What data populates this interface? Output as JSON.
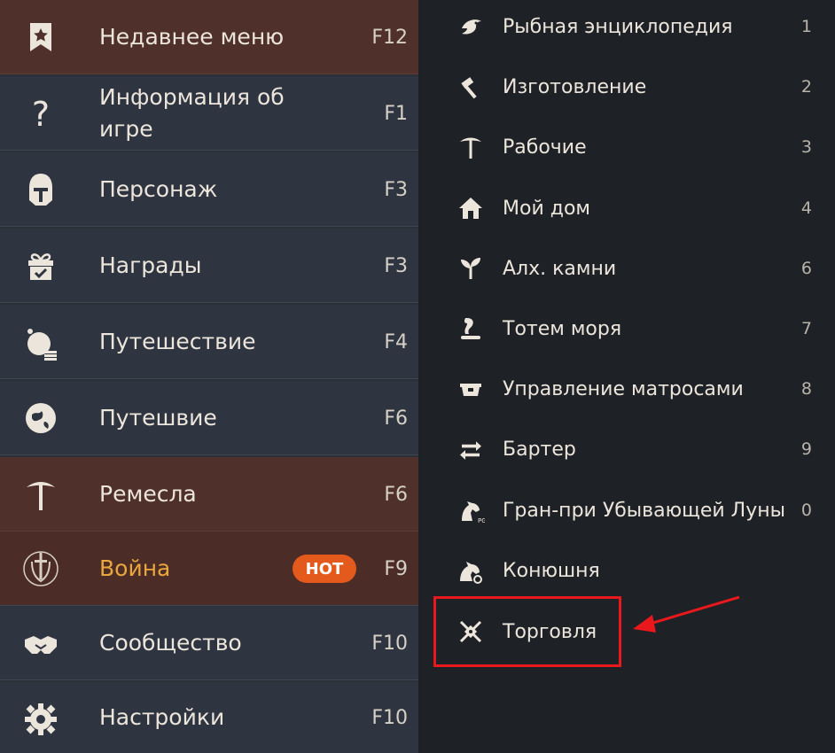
{
  "left_menu": [
    {
      "label": "Недавнее меню",
      "key": "F12",
      "icon": "bookmark-star-icon",
      "highlight": "brown"
    },
    {
      "label": "Информация об игре",
      "key": "F1",
      "icon": "question-icon"
    },
    {
      "label": "Персонаж",
      "key": "F3",
      "icon": "knight-helmet-icon"
    },
    {
      "label": "Награды",
      "key": "F3",
      "icon": "gift-box-icon"
    },
    {
      "label": "Путешествие",
      "key": "F4",
      "icon": "coin-globe-icon"
    },
    {
      "label": "Путешвие",
      "key": "F6",
      "icon": "world-map-icon"
    },
    {
      "label": "Ремесла",
      "key": "F6",
      "icon": "pickaxe-icon",
      "highlight": "brown"
    },
    {
      "label": "Война",
      "key": "F9",
      "icon": "sword-shield-icon",
      "highlight": "brown",
      "badge": "HOT",
      "label_color": "#e9a73d"
    },
    {
      "label": "Сообщество",
      "key": "F10",
      "icon": "handshake-icon"
    },
    {
      "label": "Настройки",
      "key": "F10",
      "icon": "gear-icon"
    }
  ],
  "right_menu": [
    {
      "label": "Рыбная энциклопедия",
      "key": "1",
      "icon": "fish-icon"
    },
    {
      "label": "Изготовление",
      "key": "2",
      "icon": "hammer-icon"
    },
    {
      "label": "Рабочие",
      "key": "3",
      "icon": "worker-pickaxe-icon"
    },
    {
      "label": "Мой дом",
      "key": "4",
      "icon": "house-icon"
    },
    {
      "label": "Алх. камни",
      "key": "6",
      "icon": "sprout-icon"
    },
    {
      "label": "Тотем моря",
      "key": "7",
      "icon": "sea-totem-icon"
    },
    {
      "label": "Управление матросами",
      "key": "8",
      "icon": "ship-chest-icon"
    },
    {
      "label": "Бартер",
      "key": "9",
      "icon": "swap-arrows-icon"
    },
    {
      "label": "Гран-при Убывающей Луны",
      "key": "0",
      "icon": "horse-race-icon"
    },
    {
      "label": "Конюшня",
      "key": "",
      "icon": "stable-horse-icon"
    },
    {
      "label": "Торговля",
      "key": "",
      "icon": "crossed-trade-icon",
      "annotated": true
    }
  ],
  "colors": {
    "accent_highlight": "#e8181c",
    "hot_badge": "#e35a1c",
    "row_brown": "#4f302a",
    "panel_dark": "#1e2126"
  }
}
